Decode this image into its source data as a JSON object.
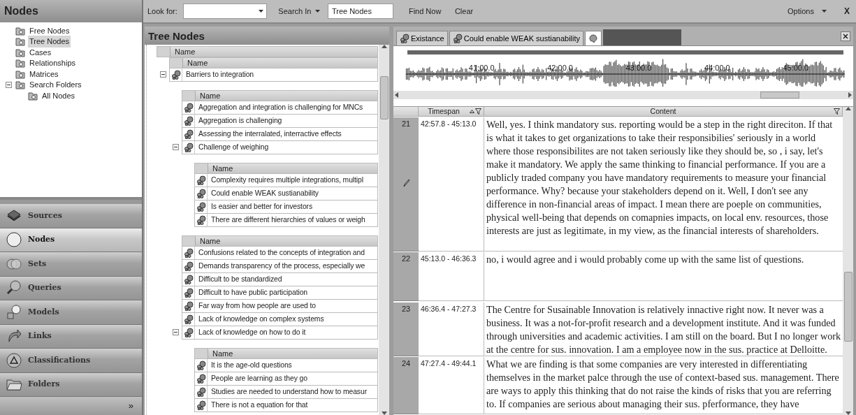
{
  "toolbar": {
    "look_for_label": "Look for:",
    "search_in": "Search In",
    "search_in_value": "Tree Nodes",
    "find_now": "Find Now",
    "clear": "Clear",
    "options": "Options",
    "close": "X"
  },
  "nodes_panel": {
    "title": "Nodes",
    "items": [
      {
        "label": "Free Nodes",
        "selected": false
      },
      {
        "label": "Tree Nodes",
        "selected": true
      },
      {
        "label": "Cases",
        "selected": false
      },
      {
        "label": "Relationships",
        "selected": false
      },
      {
        "label": "Matrices",
        "selected": false
      },
      {
        "label": "Search Folders",
        "selected": false,
        "expanded": true,
        "children": [
          {
            "label": "All Nodes",
            "selected": false
          }
        ]
      }
    ]
  },
  "navigation": [
    {
      "label": "Sources",
      "kind": "sources",
      "selected": false
    },
    {
      "label": "Nodes",
      "kind": "nodes",
      "selected": true
    },
    {
      "label": "Sets",
      "kind": "sets",
      "selected": false
    },
    {
      "label": "Queries",
      "kind": "queries",
      "selected": false
    },
    {
      "label": "Models",
      "kind": "models",
      "selected": false
    },
    {
      "label": "Links",
      "kind": "links",
      "selected": false
    },
    {
      "label": "Classifications",
      "kind": "classifications",
      "selected": false
    },
    {
      "label": "Folders",
      "kind": "folders",
      "selected": false
    }
  ],
  "navigation_more": "»",
  "tree_panel": {
    "title": "Tree Nodes",
    "tree": {
      "header": "Name",
      "children": [
        {
          "header": "Name",
          "items": [
            {
              "label": "Barriers to integration",
              "expanded": true,
              "children": [
                {
                  "header": "Name",
                  "items": [
                    {
                      "label": "Aggregation and integration is challenging for MNCs"
                    },
                    {
                      "label": "Aggregation is challenging"
                    },
                    {
                      "label": "Assessing the interralated, interractive effects"
                    },
                    {
                      "label": "Challenge of weighing",
                      "expanded": true,
                      "children": [
                        {
                          "header": "Name",
                          "items": [
                            {
                              "label": "Complexity requires multiple integrations, multipl"
                            },
                            {
                              "label": "Could enable WEAK sustianability"
                            },
                            {
                              "label": "Is easier and better for investors"
                            },
                            {
                              "label": "There are different hierarchies of values or weigh"
                            }
                          ]
                        }
                      ]
                    }
                  ]
                },
                {
                  "header": "Name",
                  "items": [
                    {
                      "label": "Confusions related to the concepts of integration and"
                    },
                    {
                      "label": "Demands transparency of the process, especially we"
                    },
                    {
                      "label": "Difficult to be standardized"
                    },
                    {
                      "label": "Difficult to have public participation"
                    },
                    {
                      "label": "Far way from how people are used to"
                    },
                    {
                      "label": "Lack of knowledge on complex systems"
                    },
                    {
                      "label": "Lack of knowledge on how to do it",
                      "expanded": true,
                      "children": [
                        {
                          "header": "Name",
                          "items": [
                            {
                              "label": "It is the age-old questions"
                            },
                            {
                              "label": "People are learning as they go"
                            },
                            {
                              "label": "Studies are needed to understand how to measur"
                            },
                            {
                              "label": "There is not a equation for that"
                            }
                          ]
                        }
                      ]
                    }
                  ]
                }
              ]
            }
          ]
        }
      ]
    }
  },
  "source_tabs": [
    {
      "label": "Existance",
      "kind": "node",
      "selected": false
    },
    {
      "label": "Could enable WEAK sustianability",
      "kind": "node",
      "selected": false
    },
    {
      "kind": "media",
      "selected": true
    }
  ],
  "media": {
    "timeline_labels": [
      "41:00.0",
      "42:00.0",
      "43:00.0",
      "44:00.0",
      "45:00.0"
    ]
  },
  "transcript": {
    "columns": [
      {
        "label": "Timespan",
        "sorted": true,
        "filter": true
      },
      {
        "label": "Content",
        "filter": true
      }
    ],
    "rows": [
      {
        "number": "21",
        "timespan": "42:57.8 - 45:13.0",
        "annotated": true,
        "content": "Well, yes. I think mandatory sus. reporting would be a step in the right direciton. If that is what it takes to get organizations to take their responsibilies' seriously in a world where those responsibilites are not taken seriously like they should be, so , i say, let's make it mandatory. We apply the same thinking to financial performance. If you are a publicly traded company you have mandatory requirements to measure your financial performance. Why? because your stakeholders depend on it. Well, I don't see any difference  in non-financial areas of impact. I mean there are poeple on communities, physical well-being that depends on comapnies impacts, on local env. resources, those interests are just as legitimate, in my view, as the financial interests of shareholders."
      },
      {
        "number": "22",
        "timespan": "45:13.0 - 46:36.3",
        "content": "no, i would agree and i would probably come up with the same list of questions."
      },
      {
        "number": "23",
        "timespan": "46:36.4 - 47:27.3",
        "content": "The Centre for Susainable Innovation is relatively innactive right now. It never was a business. It was a not-for-profit research and a development institute. And it was funded through universities and academic activities. I am still on the board. But I no longer work at the centre for sus. innovation. I am a employee now in the sus. practice at Delloitte."
      },
      {
        "number": "24",
        "timespan": "47:27.4 - 49:44.1",
        "content": "What we are finding is that some companies are very interested in differentiating themselves in the market palce through the use of context-based sus. management. There are ways to apply this thinking that do not raise the kinds of risks that you are referring to. If companies are serious about managing their sus. pferformance, they have"
      }
    ]
  }
}
